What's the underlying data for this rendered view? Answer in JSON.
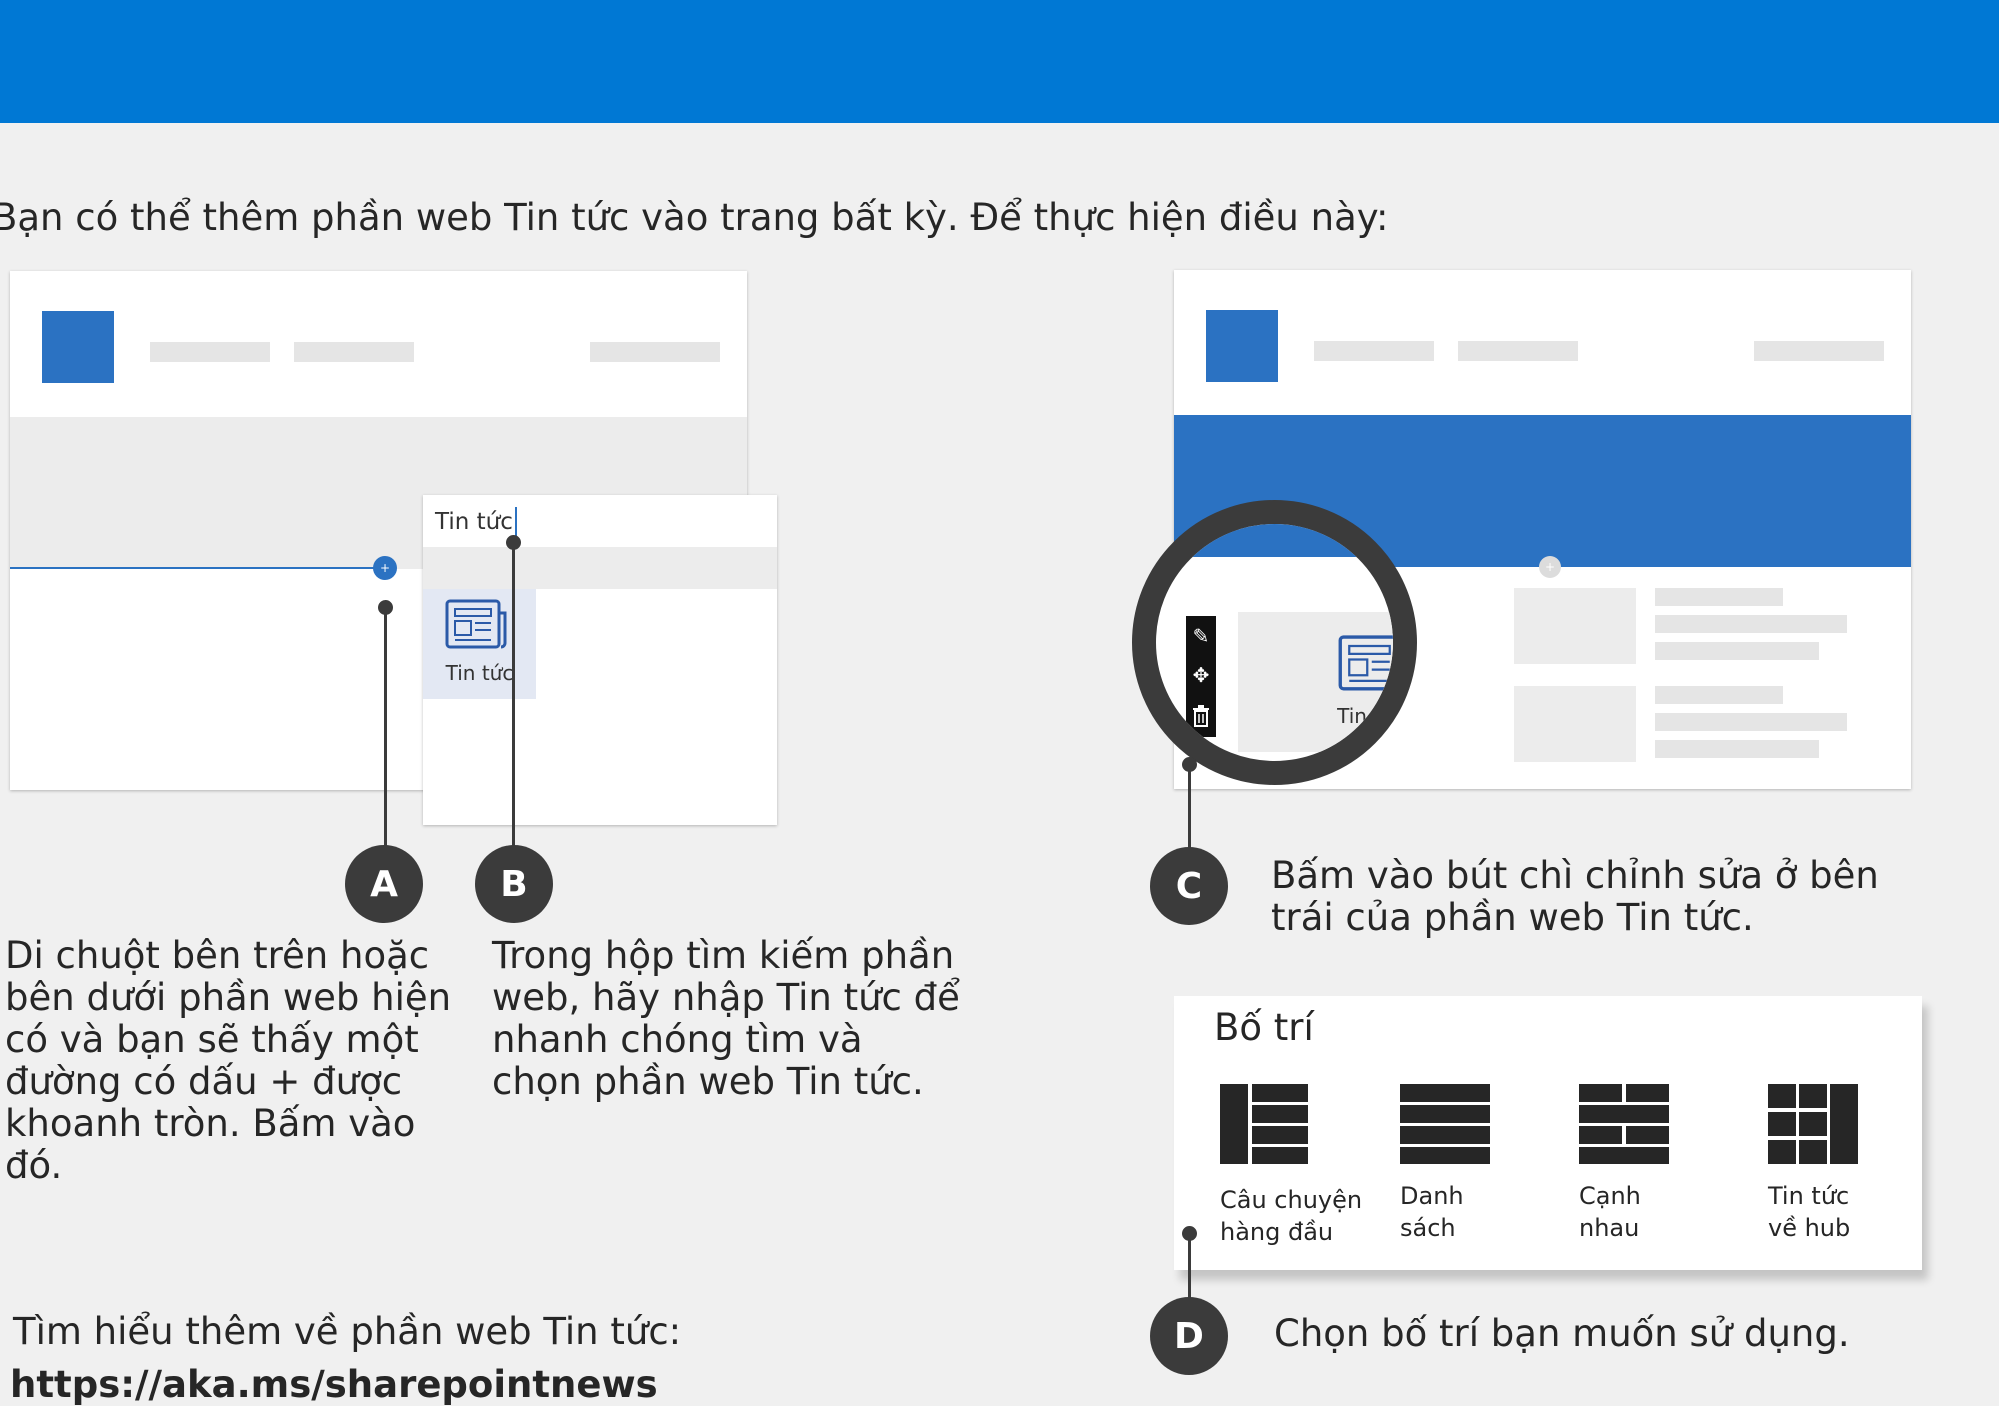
{
  "intro": "Bạn có thể thêm phần web Tin tức vào trang bất kỳ. Để thực hiện điều này:",
  "screenshot_a": {
    "search_value": "Tin tức",
    "tile_label": "Tin tức"
  },
  "screenshot_c": {
    "tile_label": "Tin tức"
  },
  "steps": {
    "a": {
      "badge": "A",
      "text": "Di chuột bên trên hoặc bên dưới phần web hiện có và bạn sẽ thấy một đường có dấu + được khoanh tròn. Bấm vào đó."
    },
    "b": {
      "badge": "B",
      "text": "Trong hộp tìm kiếm phần web, hãy nhập Tin tức để nhanh chóng tìm và chọn phần web Tin tức."
    },
    "c": {
      "badge": "C",
      "text": "Bấm vào bút chì chỉnh sửa ở bên trái của phần web Tin tức."
    },
    "d": {
      "badge": "D",
      "text": "Chọn bố trí bạn muốn sử dụng."
    }
  },
  "layout_panel": {
    "title": "Bố trí",
    "options": [
      {
        "line1": "Câu chuyện",
        "line2": "hàng đầu",
        "icon": "top-story-layout-icon"
      },
      {
        "line1": "Danh",
        "line2": "sách",
        "icon": "list-layout-icon"
      },
      {
        "line1": "Cạnh",
        "line2": "nhau",
        "icon": "side-by-side-layout-icon"
      },
      {
        "line1": "Tin tức",
        "line2": "về hub",
        "icon": "hub-news-layout-icon"
      }
    ]
  },
  "learn_more": {
    "text": "Tìm hiểu thêm về phần web Tin tức:",
    "link": "https://aka.ms/sharepointnews"
  },
  "colors": {
    "banner": "#0078d4",
    "accent": "#2b72c2",
    "badge": "#3b3b3b"
  }
}
